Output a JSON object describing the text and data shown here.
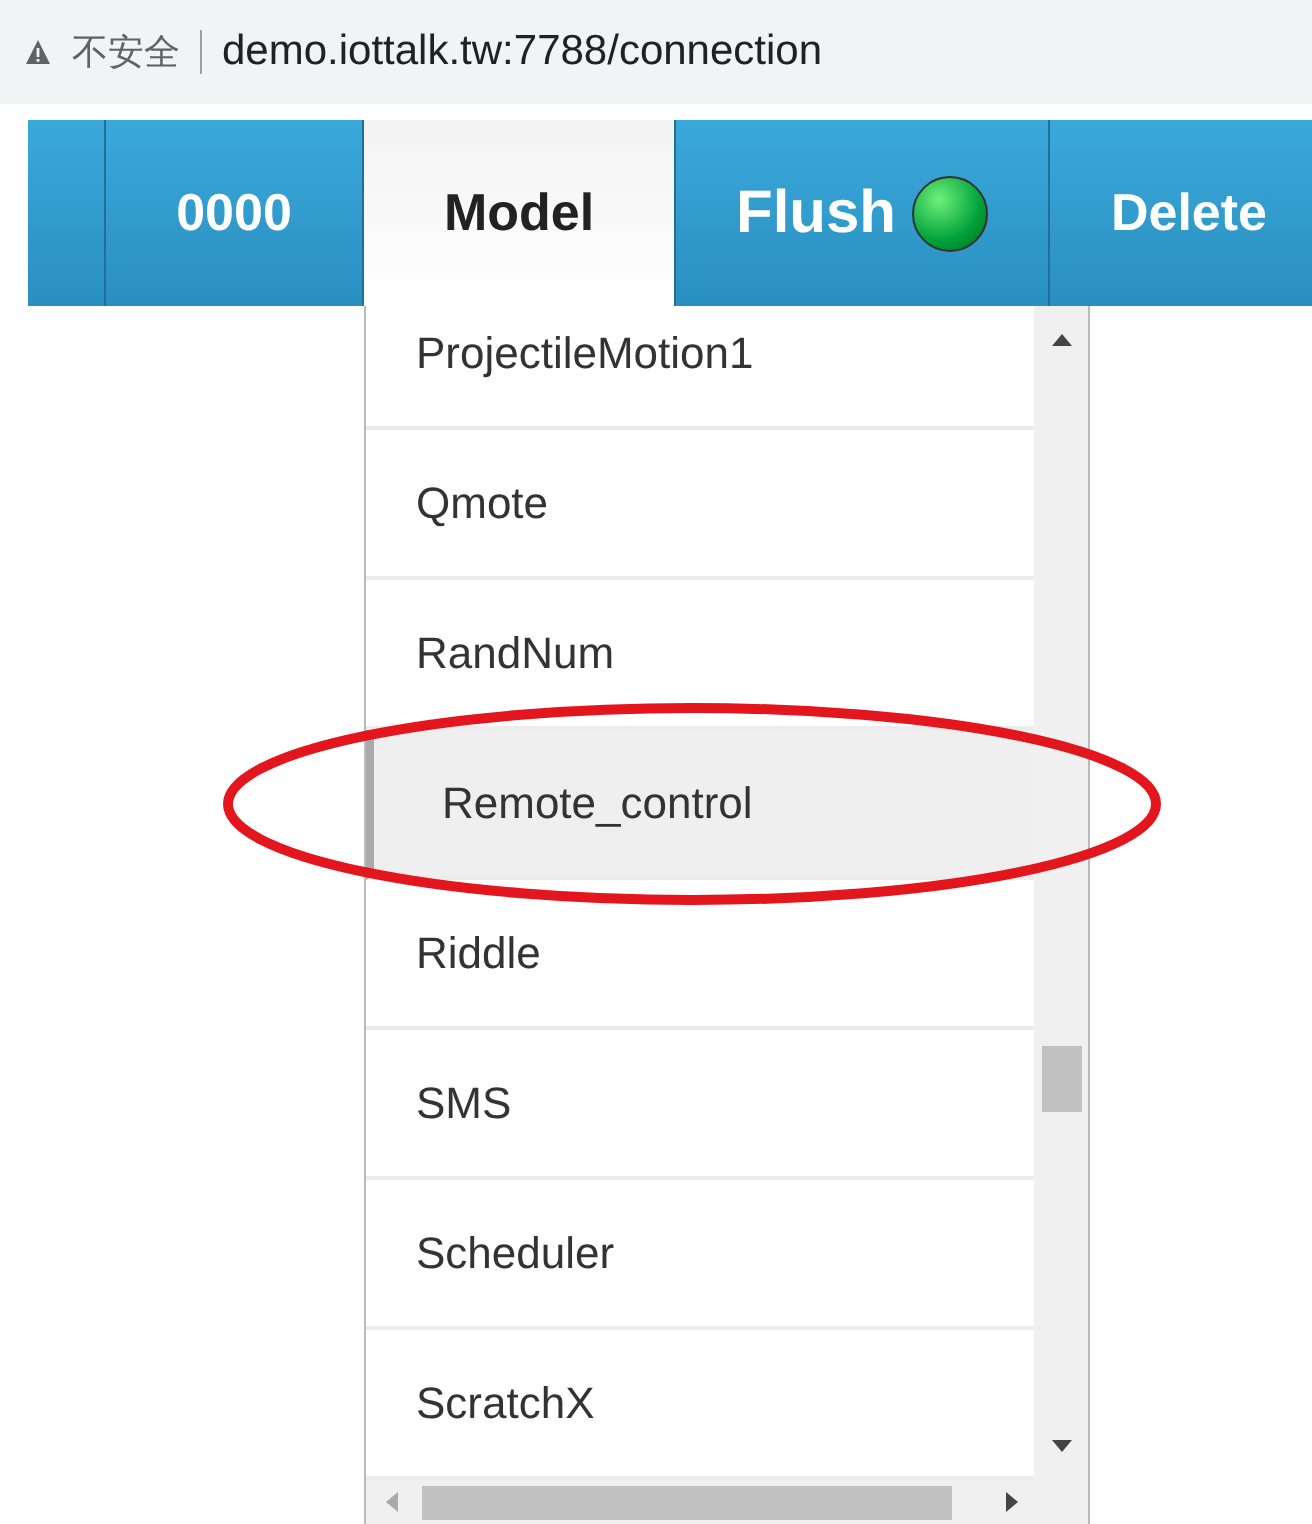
{
  "address_bar": {
    "security": "不安全",
    "url": "demo.iottalk.tw:7788/connection"
  },
  "tabs": [
    {
      "kind": "blank",
      "selected": false
    },
    {
      "label": "0000",
      "kind": "text",
      "selected": false
    },
    {
      "label": "Model",
      "kind": "text",
      "selected": true
    },
    {
      "label": "Flush",
      "kind": "indicator",
      "selected": false,
      "on": true
    },
    {
      "label": "Delete",
      "kind": "text",
      "selected": false
    }
  ],
  "dropdown": {
    "items": [
      {
        "label": "ProjectileMotion1",
        "selected": false
      },
      {
        "label": "Qmote",
        "selected": false
      },
      {
        "label": "RandNum",
        "selected": false
      },
      {
        "label": "Remote_control",
        "selected": true
      },
      {
        "label": "Riddle",
        "selected": false
      },
      {
        "label": "SMS",
        "selected": false
      },
      {
        "label": "Scheduler",
        "selected": false
      },
      {
        "label": "ScratchX",
        "selected": false
      }
    ]
  }
}
